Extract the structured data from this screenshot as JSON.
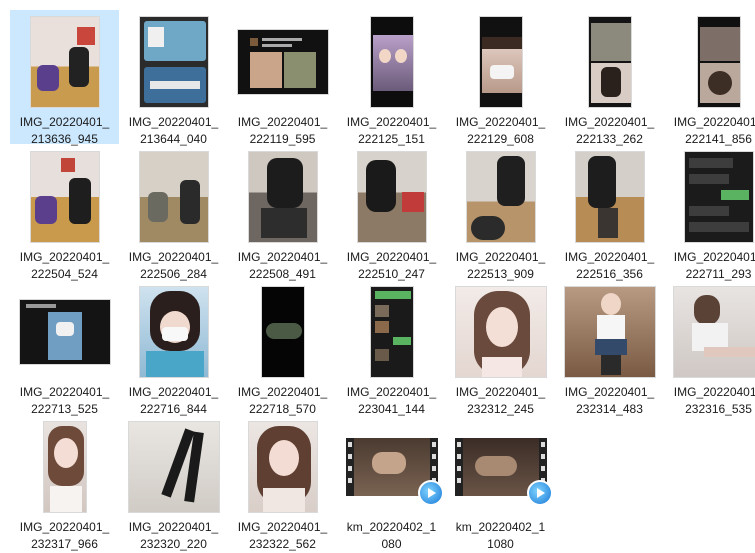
{
  "files": [
    {
      "label": "IMG_20220401_\n213636_945",
      "selected": true
    },
    {
      "label": "IMG_20220401_\n213644_040"
    },
    {
      "label": "IMG_20220401_\n222119_595"
    },
    {
      "label": "IMG_20220401_\n222125_151"
    },
    {
      "label": "IMG_20220401_\n222129_608"
    },
    {
      "label": "IMG_20220401_\n222133_262"
    },
    {
      "label": "IMG_20220401_\n222141_856"
    },
    {
      "label": "IMG_20220401_\n222504_524"
    },
    {
      "label": "IMG_20220401_\n222506_284"
    },
    {
      "label": "IMG_20220401_\n222508_491"
    },
    {
      "label": "IMG_20220401_\n222510_247"
    },
    {
      "label": "IMG_20220401_\n222513_909"
    },
    {
      "label": "IMG_20220401_\n222516_356"
    },
    {
      "label": "IMG_20220401_\n222711_293"
    },
    {
      "label": "IMG_20220401_\n222713_525"
    },
    {
      "label": "IMG_20220401_\n222716_844"
    },
    {
      "label": "IMG_20220401_\n222718_570"
    },
    {
      "label": "IMG_20220401_\n223041_144"
    },
    {
      "label": "IMG_20220401_\n232312_245"
    },
    {
      "label": "IMG_20220401_\n232314_483"
    },
    {
      "label": "IMG_20220401_\n232316_535"
    },
    {
      "label": "IMG_20220401_\n232317_966"
    },
    {
      "label": "IMG_20220401_\n232320_220"
    },
    {
      "label": "IMG_20220401_\n232322_562"
    },
    {
      "label": "km_20220402_1\n080"
    },
    {
      "label": "km_20220402_1\n1080"
    }
  ],
  "colors": {
    "selection": "#cce8ff",
    "text": "#1a1a1a"
  }
}
